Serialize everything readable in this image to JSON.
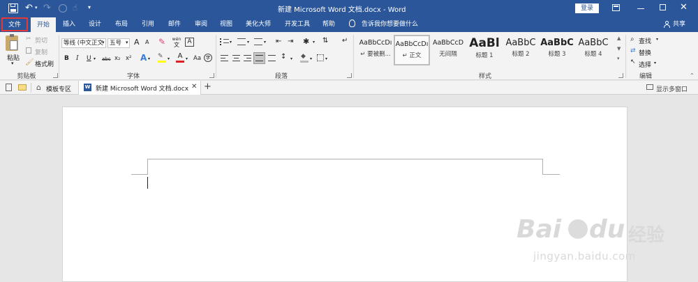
{
  "titlebar": {
    "title": "新建 Microsoft Word 文档.docx  -  Word",
    "login_label": "登录",
    "icons": [
      "save-icon",
      "undo-icon",
      "redo-icon",
      "circle-icon",
      "touch-mode-icon",
      "customize-icon"
    ],
    "window_controls": [
      "ribbon-display-icon",
      "minimize-icon",
      "restore-icon",
      "close-icon"
    ]
  },
  "tabs": {
    "file": "文件",
    "items": [
      "开始",
      "插入",
      "设计",
      "布局",
      "引用",
      "邮件",
      "审阅",
      "视图",
      "美化大师",
      "开发工具",
      "帮助"
    ],
    "active": "开始",
    "tell_me": "告诉我你想要做什么",
    "share": "共享"
  },
  "ribbon": {
    "clipboard": {
      "label": "剪贴板",
      "paste": "粘贴",
      "cut": "剪切",
      "copy": "复制",
      "format_painter": "格式刷"
    },
    "font": {
      "label": "字体",
      "font_name": "等线 (中文正文",
      "font_size": "五号",
      "wen": "wén",
      "wen_char": "文",
      "grow": "A",
      "shrink": "A",
      "aa": "Aa",
      "bold": "B",
      "italic": "I",
      "underline": "U",
      "strike": "abc",
      "subscript": "x₂",
      "superscript": "x²",
      "font_color": "A",
      "char_circle": "字",
      "char_border": "A"
    },
    "paragraph": {
      "label": "段落"
    },
    "styles": {
      "label": "样式",
      "items": [
        {
          "preview": "AaBbCcDı",
          "name": "↵ 要被删..."
        },
        {
          "preview": "AaBbCcDı",
          "name": "↵ 正文"
        },
        {
          "preview": "AaBbCcD",
          "name": "无间隔"
        },
        {
          "preview": "AaBl",
          "name": "标题 1"
        },
        {
          "preview": "AaBbC",
          "name": "标题 2"
        },
        {
          "preview": "AaBbC",
          "name": "标题 3"
        },
        {
          "preview": "AaBbC",
          "name": "标题 4"
        }
      ]
    },
    "editing": {
      "label": "编辑",
      "find": "查找",
      "replace": "替换",
      "select": "选择"
    }
  },
  "doctabs": {
    "template": "模板专区",
    "document": "新建 Microsoft Word 文档.docx",
    "multi_window": "显示多窗口"
  },
  "watermark": {
    "brand": "Bai",
    "brand2": "du",
    "cn": "经验",
    "url": "jingyan.baidu.com"
  }
}
